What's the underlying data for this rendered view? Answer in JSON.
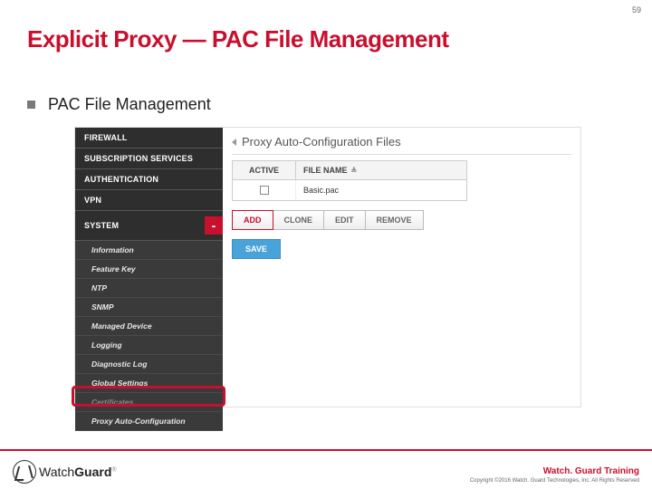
{
  "page_number": "59",
  "title": "Explicit Proxy — PAC File Management",
  "bullet": "PAC File Management",
  "sidebar": {
    "top": [
      {
        "label": "FIREWALL"
      },
      {
        "label": "SUBSCRIPTION SERVICES"
      },
      {
        "label": "AUTHENTICATION"
      },
      {
        "label": "VPN"
      },
      {
        "label": "SYSTEM",
        "collapse_icon": "-"
      }
    ],
    "sub": [
      "Information",
      "Feature Key",
      "NTP",
      "SNMP",
      "Managed Device",
      "Logging",
      "Diagnostic Log",
      "Global Settings",
      "Certificates",
      "Proxy Auto-Configuration"
    ]
  },
  "panel": {
    "title": "Proxy Auto-Configuration Files",
    "columns": {
      "active": "ACTIVE",
      "filename": "FILE NAME",
      "sort_glyph": "≜"
    },
    "rows": [
      {
        "active": false,
        "filename": "Basic.pac"
      }
    ],
    "buttons": {
      "add": "ADD",
      "clone": "CLONE",
      "edit": "EDIT",
      "remove": "REMOVE",
      "save": "SAVE"
    }
  },
  "footer": {
    "brand_a": "Watch",
    "brand_b": "Guard",
    "reg": "®",
    "training": "Watch. Guard Training",
    "copyright": "Copyright ©2016 Watch. Guard Technologies, Inc. All Rights Reserved"
  }
}
